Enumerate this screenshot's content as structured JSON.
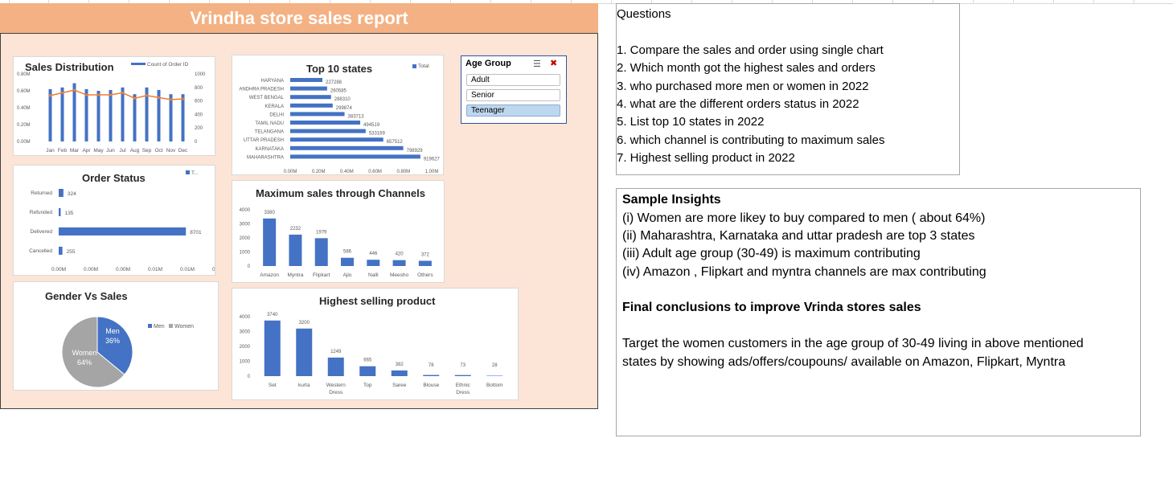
{
  "dashboard": {
    "title": "Vrindha store sales report"
  },
  "sales_distribution": {
    "title": "Sales Distribution",
    "legend": "Count of Order ID",
    "left_ticks": [
      "0.80M",
      "0.60M",
      "0.40M",
      "0.20M",
      "0.00M"
    ],
    "right_ticks": [
      "1000",
      "800",
      "600",
      "400",
      "200",
      "0"
    ]
  },
  "order_status": {
    "title": "Order Status",
    "legend": "T...",
    "x_ticks": [
      "0.00M",
      "0.00M",
      "0.00M",
      "0.01M",
      "0.01M",
      "0.01M"
    ]
  },
  "gender": {
    "title": "Gender Vs Sales",
    "men_label": "Men",
    "men_pct": "36%",
    "women_label": "Women",
    "women_pct": "64%",
    "legend_men": "Men",
    "legend_women": "Women"
  },
  "top_states": {
    "title": "Top 10 states",
    "legend": "Total",
    "x_ticks": [
      "0.00M",
      "0.20M",
      "0.40M",
      "0.60M",
      "0.80M",
      "1.00M"
    ]
  },
  "channels": {
    "title": "Maximum sales through Channels",
    "y_ticks": [
      "4000",
      "3000",
      "2000",
      "1000",
      "0"
    ]
  },
  "products": {
    "title": "Highest selling product",
    "y_ticks": [
      "4000",
      "3000",
      "2000",
      "1000",
      "0"
    ]
  },
  "slicer": {
    "header": "Age Group",
    "filter_icon": "multi-select-icon",
    "clear_icon": "clear-filter-icon",
    "items": [
      "Adult",
      "Senior",
      "Teenager"
    ],
    "selected": "Teenager"
  },
  "questions": {
    "heading": "Questions",
    "items": [
      "1. Compare the sales and order using single chart",
      "2. Which month got the highest sales and orders",
      "3. who purchased more men or women in 2022",
      "4. what are the different orders status in 2022",
      "5. List top 10 states in 2022",
      "6. which channel is contributing to maximum sales",
      "7. Highest selling product in 2022"
    ]
  },
  "insights": {
    "heading": "Sample Insights",
    "items": [
      "(i) Women are more likey to buy compared to men ( about 64%)",
      "(ii) Maharashtra, Karnataka and uttar pradesh are top 3 states",
      "(iii) Adult age group (30-49) is maximum contributing",
      "(iv) Amazon , Flipkart and myntra channels are max contributing"
    ],
    "conclusion_heading": "Final conclusions to improve Vrinda stores sales",
    "conclusion_lines": [
      "Target the women customers in the age group of 30-49 living in above mentioned",
      "states by showing ads/offers/coupouns/ available on Amazon, Flipkart, Myntra"
    ]
  },
  "colors": {
    "bar": "#4472c4",
    "line": "#ed7d31",
    "header": "#f4b183",
    "background": "#fce4d6",
    "women": "#a5a5a5"
  },
  "chart_data": [
    {
      "type": "bar",
      "title": "Sales Distribution",
      "categories": [
        "Jan",
        "Feb",
        "Mar",
        "Apr",
        "May",
        "Jun",
        "Jul",
        "Aug",
        "Sep",
        "Oct",
        "Nov",
        "Dec"
      ],
      "series": [
        {
          "name": "Sales",
          "values": [
            0.62,
            0.64,
            0.69,
            0.62,
            0.6,
            0.61,
            0.64,
            0.56,
            0.64,
            0.61,
            0.56,
            0.56
          ]
        },
        {
          "name": "Count of Order ID",
          "values": [
            680,
            720,
            760,
            690,
            690,
            690,
            720,
            640,
            680,
            650,
            620,
            630
          ]
        }
      ],
      "ylim": [
        0,
        0.8
      ],
      "y2lim": [
        0,
        1000
      ]
    },
    {
      "type": "bar",
      "title": "Order Status",
      "categories": [
        "Returned",
        "Refunded",
        "Delivered",
        "Cancelled"
      ],
      "values": [
        324,
        135,
        8701,
        255
      ]
    },
    {
      "type": "pie",
      "title": "Gender Vs Sales",
      "categories": [
        "Men",
        "Women"
      ],
      "values": [
        36,
        64
      ]
    },
    {
      "type": "bar",
      "title": "Top 10 states",
      "categories": [
        "HARYANA",
        "ANDHRA PRADESH",
        "WEST BENGAL",
        "KERALA",
        "DELHI",
        "TAMIL NADU",
        "TELANGANA",
        "UTTAR PRADESH",
        "KARNATAKA",
        "MAHARASHTRA"
      ],
      "values": [
        227288,
        260585,
        288310,
        299874,
        383713,
        494519,
        533169,
        657512,
        798929,
        919627
      ],
      "xlim": [
        0,
        1000000
      ]
    },
    {
      "type": "bar",
      "title": "Maximum sales through Channels",
      "categories": [
        "Amazon",
        "Myntra",
        "Flipkart",
        "Ajio",
        "Nalli",
        "Meesho",
        "Others"
      ],
      "values": [
        3380,
        2232,
        1979,
        586,
        446,
        420,
        372
      ],
      "ylim": [
        0,
        4000
      ]
    },
    {
      "type": "bar",
      "title": "Highest selling product",
      "categories": [
        "Set",
        "kurta",
        "Western Dress",
        "Top",
        "Saree",
        "Blouse",
        "Ethnic Dress",
        "Bottom"
      ],
      "values": [
        3740,
        3200,
        1249,
        665,
        382,
        78,
        73,
        28
      ],
      "ylim": [
        0,
        4000
      ]
    }
  ]
}
